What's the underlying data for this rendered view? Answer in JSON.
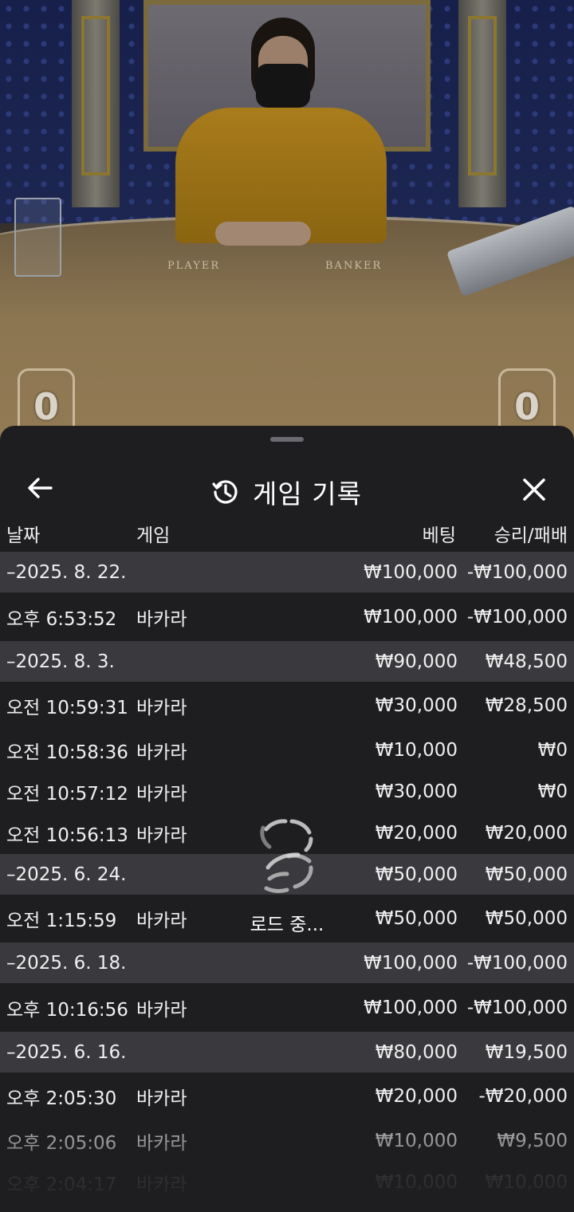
{
  "video": {
    "table_labels": [
      "PLAYER",
      "BANKER"
    ],
    "player_score": "0",
    "banker_score": "0"
  },
  "sheet": {
    "title": "게임 기록",
    "icons": {
      "back": "arrow-left-icon",
      "history": "history-icon",
      "close": "close-icon"
    }
  },
  "columns": {
    "date": "날짜",
    "game": "게임",
    "bet": "베팅",
    "win": "승리/패배"
  },
  "rows": [
    {
      "type": "date",
      "date": "–2025. 8. 22.",
      "bet": "₩100,000",
      "win": "-₩100,000"
    },
    {
      "type": "item",
      "date": "오후 6:53:52",
      "game": "바카라",
      "bet": "₩100,000",
      "win": "-₩100,000"
    },
    {
      "type": "date",
      "date": "–2025. 8. 3.",
      "bet": "₩90,000",
      "win": "₩48,500"
    },
    {
      "type": "item",
      "date": "오전 10:59:31",
      "game": "바카라",
      "bet": "₩30,000",
      "win": "₩28,500"
    },
    {
      "type": "item",
      "date": "오전 10:58:36",
      "game": "바카라",
      "bet": "₩10,000",
      "win": "₩0"
    },
    {
      "type": "item",
      "date": "오전 10:57:12",
      "game": "바카라",
      "bet": "₩30,000",
      "win": "₩0"
    },
    {
      "type": "item",
      "date": "오전 10:56:13",
      "game": "바카라",
      "bet": "₩20,000",
      "win": "₩20,000"
    },
    {
      "type": "date",
      "date": "–2025. 6. 24.",
      "bet": "₩50,000",
      "win": "₩50,000"
    },
    {
      "type": "item",
      "date": "오전 1:15:59",
      "game": "바카라",
      "bet": "₩50,000",
      "win": "₩50,000"
    },
    {
      "type": "date",
      "date": "–2025. 6. 18.",
      "bet": "₩100,000",
      "win": "-₩100,000"
    },
    {
      "type": "item",
      "date": "오후 10:16:56",
      "game": "바카라",
      "bet": "₩100,000",
      "win": "-₩100,000"
    },
    {
      "type": "date",
      "date": "–2025. 6. 16.",
      "bet": "₩80,000",
      "win": "₩19,500"
    },
    {
      "type": "item",
      "date": "오후 2:05:30",
      "game": "바카라",
      "bet": "₩20,000",
      "win": "-₩20,000"
    },
    {
      "type": "item",
      "date": "오후 2:05:06",
      "game": "바카라",
      "bet": "₩10,000",
      "win": "₩9,500"
    },
    {
      "type": "item",
      "date": "오후 2:04:17",
      "game": "바카라",
      "bet": "₩10,000",
      "win": "₩10,000"
    }
  ],
  "loading": {
    "text": "로드 중..."
  }
}
